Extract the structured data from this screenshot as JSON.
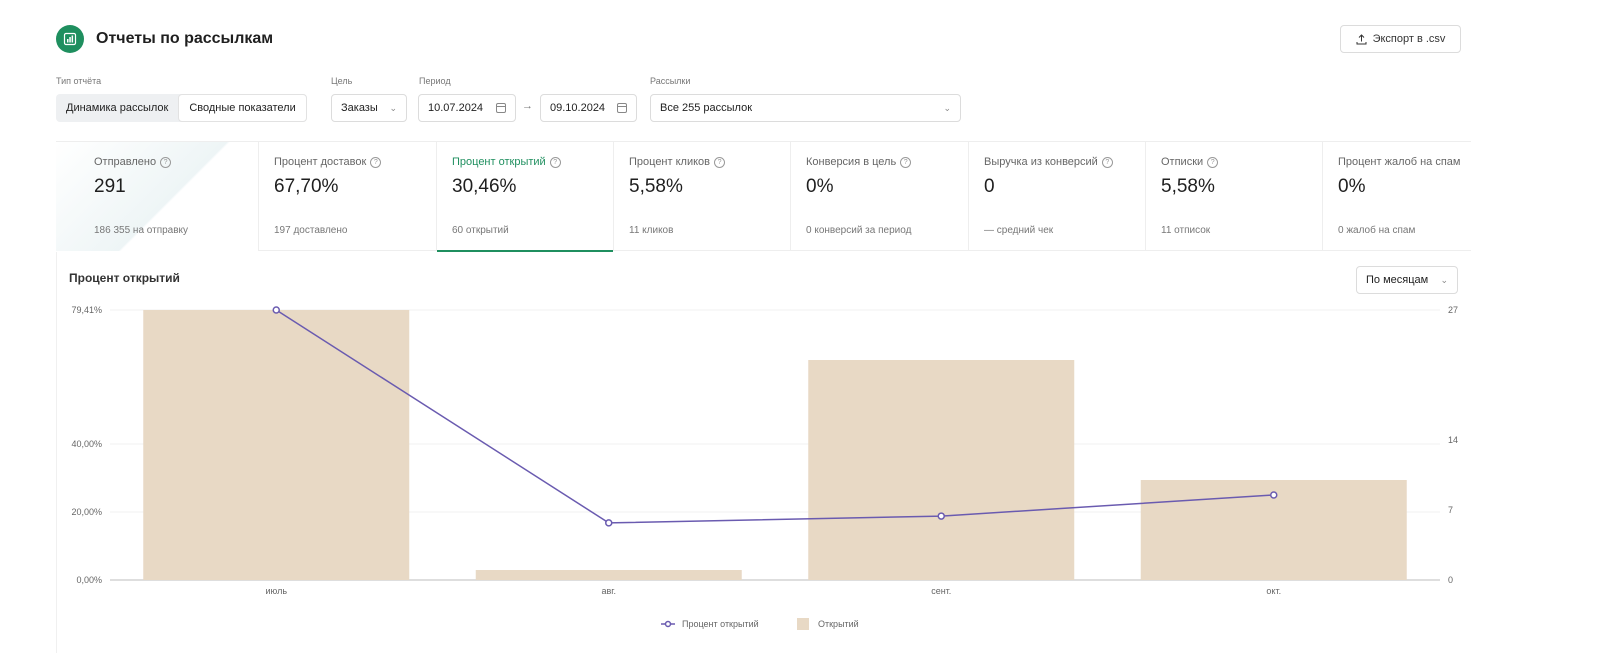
{
  "header": {
    "title": "Отчеты по рассылкам",
    "export_label": "Экспорт в .csv"
  },
  "filters": {
    "report_type_label": "Тип отчёта",
    "report_types": [
      "Динамика рассылок",
      "Сводные показатели"
    ],
    "active_report_type": 1,
    "goal_label": "Цель",
    "goal_value": "Заказы",
    "period_label": "Период",
    "period_from": "10.07.2024",
    "period_to": "09.10.2024",
    "period_separator": "→",
    "mailings_label": "Рассылки",
    "mailings_value": "Все 255 рассылок"
  },
  "metrics": [
    {
      "label": "Отправлено",
      "value": "291",
      "sub": "186 355 на отправку"
    },
    {
      "label": "Процент доставок",
      "value": "67,70%",
      "sub": "197 доставлено"
    },
    {
      "label": "Процент открытий",
      "value": "30,46%",
      "sub": "60 открытий",
      "active": true
    },
    {
      "label": "Процент кликов",
      "value": "5,58%",
      "sub": "11 кликов"
    },
    {
      "label": "Конверсия в цель",
      "value": "0%",
      "sub": "0 конверсий за период"
    },
    {
      "label": "Выручка из конверсий",
      "value": "0",
      "sub": "— средний чек"
    },
    {
      "label": "Отписки",
      "value": "5,58%",
      "sub": "11 отписок"
    },
    {
      "label": "Процент жалоб на спам",
      "value": "0%",
      "sub": "0 жалоб на спам"
    }
  ],
  "chart_panel": {
    "title": "Процент открытий",
    "period_select": "По месяцам"
  },
  "chart_data": {
    "type": "bar+line",
    "categories": [
      "июль",
      "авг.",
      "сент.",
      "окт."
    ],
    "series": [
      {
        "name": "Процент открытий",
        "type": "line",
        "axis": "left",
        "values": [
          79.41,
          16.8,
          18.8,
          25.0
        ]
      },
      {
        "name": "Открытий",
        "type": "bar",
        "axis": "right",
        "values": [
          27,
          1,
          22,
          10
        ]
      }
    ],
    "left_axis": {
      "ticks": [
        0,
        20,
        40,
        79.41
      ],
      "tick_labels": [
        "0,00%",
        "20,00%",
        "40,00%",
        "79,41%"
      ],
      "range": [
        0,
        79.41
      ]
    },
    "right_axis": {
      "ticks": [
        0,
        7,
        14,
        27
      ],
      "tick_labels": [
        "0",
        "7",
        "14",
        "27"
      ],
      "range": [
        0,
        27
      ]
    },
    "legend_position": "bottom-center",
    "colors": {
      "line": "#6a5bb0",
      "bar": "#e8d9c5",
      "accent": "#1f8f5f"
    }
  }
}
